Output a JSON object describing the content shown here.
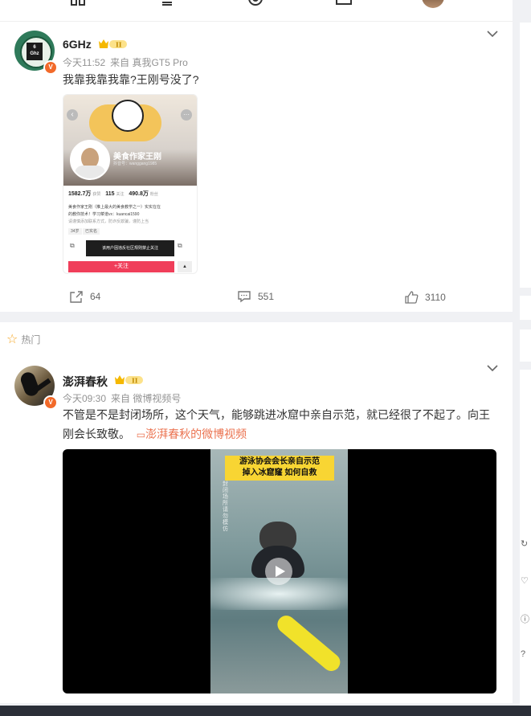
{
  "top_icons": [
    "grid-icon",
    "layers-icon",
    "video-icon",
    "message-icon"
  ],
  "posts": [
    {
      "author": "6GHz",
      "avatar_text": "6\nGhz",
      "level": "II",
      "time": "今天11:52",
      "source": "来自 真我GT5 Pro",
      "text": "我靠我靠我靠?王刚号没了?",
      "image": {
        "profile_name": "美食作家王刚",
        "id_line": "抖音号：wanggang1985",
        "likes_num": "1582.7万",
        "likes_label": "获赞",
        "follow_num": "115",
        "follow_label": "关注",
        "fans_num": "490.8万",
        "fans_label": "粉丝",
        "bio1": "美食作家王刚（推上最大的美食教学之一）实实在在",
        "bio2": "的教你技术！学习菜谱vx：kuancai1590",
        "bio3": "请谨慎添加联系方式，防诈反欺骗，谨防上当",
        "tag1": "34岁",
        "tag2": "已实名",
        "banner": "该用户因违反社区规则禁止关注",
        "follow_btn": "+关注"
      },
      "share_count": "64",
      "comment_count": "551",
      "like_count": "3110"
    },
    {
      "hot_label": "热门",
      "author": "澎湃春秋",
      "level": "II",
      "time": "今天09:30",
      "source": "来自 微博视频号",
      "text_line1": "不管是不是封闭场所，这个天气，能够跳进冰窟中亲自示范，就已经很了不起了。向王",
      "text_line2": "刚会长致敬。",
      "link": "澎湃春秋的微博视频",
      "video_caption1": "游泳协会会长亲自示范",
      "video_caption2": "掉入冰窟窿 如何自救",
      "video_side_text": "封闭场所 请勿模仿"
    }
  ],
  "colors": {
    "accent": "#eb7350",
    "vip": "#f5b800",
    "bg": "#f0f1f4"
  }
}
